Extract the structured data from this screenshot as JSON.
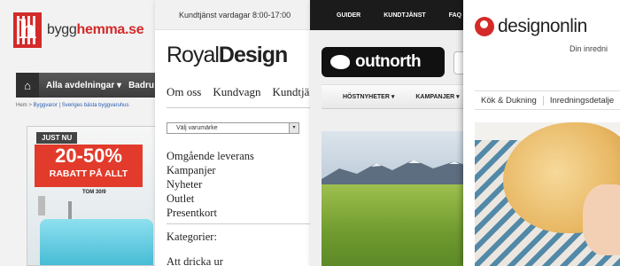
{
  "panel1": {
    "brand_prefix": "bygg",
    "brand_suffix": "hemma.se",
    "nav_all": "Alla avdelningar",
    "nav_next": "Badru",
    "breadcrumb_home": "Hem",
    "breadcrumb_link": "Byggvaror | Sveriges bästa byggvaruhus",
    "banner_tag": "JUST NU",
    "banner_percent": "20-50%",
    "banner_text": "RABATT PÅ ALLT",
    "banner_date": "TOM 30/9",
    "accent": "#d32a2a"
  },
  "panel2": {
    "topbar": "Kundtjänst vardagar 8:00-17:00",
    "logo_light": "Royal",
    "logo_bold": "Design",
    "menu": [
      "Om oss",
      "Kundvagn",
      "Kundtjä"
    ],
    "select_placeholder": "Välj varumärke",
    "links": [
      "Omgående leverans",
      "Kampanjer",
      "Nyheter",
      "Outlet",
      "Presentkort"
    ],
    "categories_label": "Kategorier:",
    "cut_link": "Att dricka ur"
  },
  "panel3": {
    "topbar": [
      "GUIDER",
      "KUNDTJÄNST",
      "FAQ"
    ],
    "logo": "outnorth",
    "categories": [
      "HÖSTNYHETER",
      "KAMPANJER"
    ]
  },
  "panel4": {
    "logo": "designonlin",
    "tagline": "Din inredni",
    "menu": [
      "Kök & Dukning",
      "Inredningsdetalje"
    ],
    "accent": "#d42a2a"
  }
}
